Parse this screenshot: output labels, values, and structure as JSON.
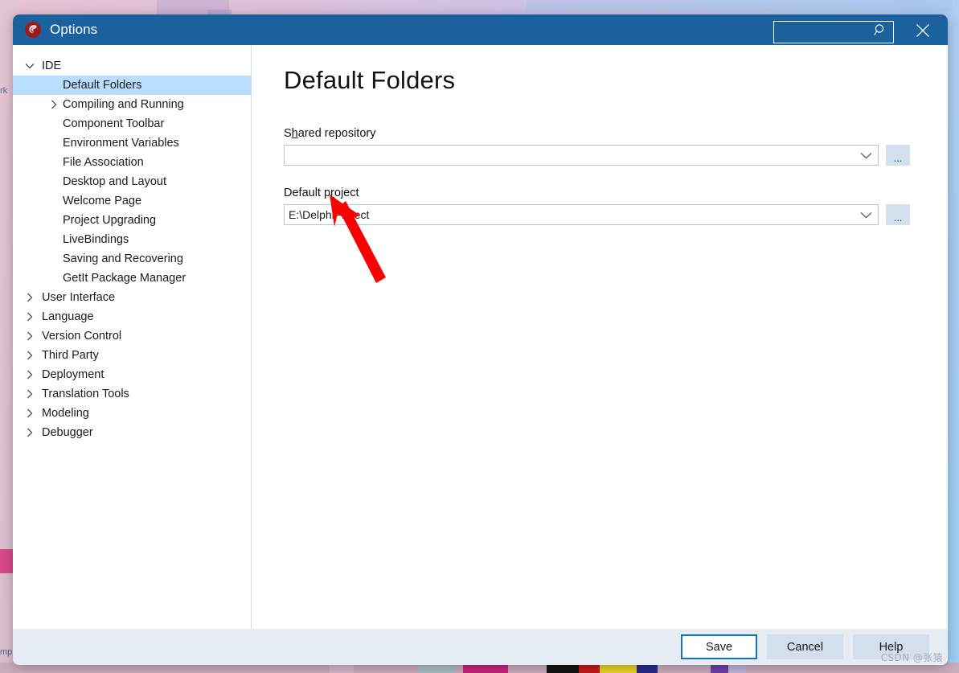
{
  "window": {
    "title": "Options",
    "icon": "delphi-logo-icon",
    "titlebar_color": "#1b619d",
    "search": {
      "value": "",
      "placeholder": "",
      "icon": "search-icon"
    },
    "close_icon": "close-icon"
  },
  "sidebar": {
    "items": [
      {
        "label": "IDE",
        "level": 0,
        "state": "expanded",
        "selected": false
      },
      {
        "label": "Default Folders",
        "level": 1,
        "state": "leaf",
        "selected": true
      },
      {
        "label": "Compiling and Running",
        "level": 1,
        "state": "collapsed",
        "selected": false
      },
      {
        "label": "Component Toolbar",
        "level": 1,
        "state": "leaf",
        "selected": false
      },
      {
        "label": "Environment Variables",
        "level": 1,
        "state": "leaf",
        "selected": false
      },
      {
        "label": "File Association",
        "level": 1,
        "state": "leaf",
        "selected": false
      },
      {
        "label": "Desktop and Layout",
        "level": 1,
        "state": "leaf",
        "selected": false
      },
      {
        "label": "Welcome Page",
        "level": 1,
        "state": "leaf",
        "selected": false
      },
      {
        "label": "Project Upgrading",
        "level": 1,
        "state": "leaf",
        "selected": false
      },
      {
        "label": "LiveBindings",
        "level": 1,
        "state": "leaf",
        "selected": false
      },
      {
        "label": "Saving and Recovering",
        "level": 1,
        "state": "leaf",
        "selected": false
      },
      {
        "label": "GetIt Package Manager",
        "level": 1,
        "state": "leaf",
        "selected": false
      },
      {
        "label": "User Interface",
        "level": 0,
        "state": "collapsed",
        "selected": false
      },
      {
        "label": "Language",
        "level": 0,
        "state": "collapsed",
        "selected": false
      },
      {
        "label": "Version Control",
        "level": 0,
        "state": "collapsed",
        "selected": false
      },
      {
        "label": "Third Party",
        "level": 0,
        "state": "collapsed",
        "selected": false
      },
      {
        "label": "Deployment",
        "level": 0,
        "state": "collapsed",
        "selected": false
      },
      {
        "label": "Translation Tools",
        "level": 0,
        "state": "collapsed",
        "selected": false
      },
      {
        "label": "Modeling",
        "level": 0,
        "state": "collapsed",
        "selected": false
      },
      {
        "label": "Debugger",
        "level": 0,
        "state": "collapsed",
        "selected": false
      }
    ],
    "selected_accent": "#badeff"
  },
  "content": {
    "page_title": "Default Folders",
    "fields": [
      {
        "label_before": "S",
        "label_accel": "h",
        "label_after": "ared repository",
        "value": "",
        "browse_label": "...",
        "dropdown_icon": "chevron-down-icon"
      },
      {
        "label_before": "Default p",
        "label_accel": "r",
        "label_after": "oject",
        "value": "E:\\DelphiProject",
        "browse_label": "...",
        "dropdown_icon": "chevron-down-icon"
      }
    ],
    "annotation": {
      "type": "red-arrow",
      "color": "#fb0000"
    }
  },
  "footer": {
    "save_label": "Save",
    "cancel_label": "Cancel",
    "help_label": "Help",
    "primary_border": "#0c72c4",
    "background": "#e6ecf4"
  },
  "watermark": {
    "text": "CSDN @张猿"
  },
  "desktop": {
    "left_text_top": "rk",
    "left_text_bottom": "mp"
  }
}
